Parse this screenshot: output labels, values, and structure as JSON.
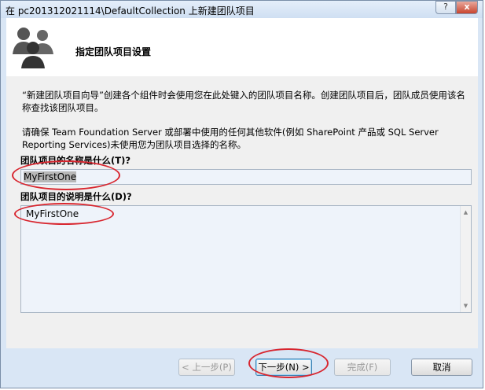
{
  "window": {
    "title": "在 pc201312021114\\DefaultCollection 上新建团队项目",
    "help_label": "?",
    "close_label": "x"
  },
  "header": {
    "title": "指定团队项目设置",
    "icon": "team-people-icon"
  },
  "content": {
    "intro_text": "“新建团队项目向导”创建各个组件时会使用您在此处键入的团队项目名称。创建团队项目后，团队成员使用该名称查找该团队项目。",
    "note_text": "请确保 Team Foundation Server 或部署中使用的任何其他软件(例如 SharePoint 产品或 SQL Server Reporting Services)未使用您为团队项目选择的名称。",
    "name_label": "团队项目的名称是什么(T)?",
    "name_value": "MyFirstOne",
    "description_label": "团队项目的说明是什么(D)?",
    "description_value": "MyFirstOne"
  },
  "buttons": {
    "back": "< 上一步(P)",
    "next": "下一步(N) >",
    "finish": "完成(F)",
    "cancel": "取消"
  },
  "colors": {
    "annotation_circle": "#d8262f",
    "window_frame": "#d9e6f5"
  }
}
